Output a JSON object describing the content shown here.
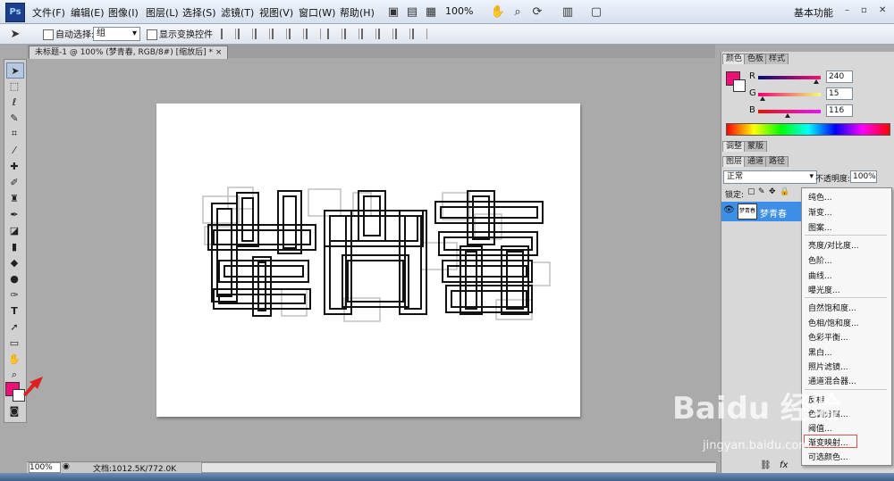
{
  "app": {
    "logo_text": "Ps"
  },
  "menu": [
    "文件(F)",
    "编辑(E)",
    "图像(I)",
    "图层(L)",
    "选择(S)",
    "滤镜(T)",
    "视图(V)",
    "窗口(W)",
    "帮助(H)"
  ],
  "toolbar": {
    "zoom_level": "100%",
    "workspace": "基本功能"
  },
  "options_bar": {
    "auto_select_label": "自动选择:",
    "auto_select_value": "组",
    "show_transform_label": "显示变换控件"
  },
  "document_tab": {
    "title": "未标题-1 @ 100% (梦青春, RGB/8#) [缩放后] *",
    "close": "×"
  },
  "status_bar": {
    "zoom": "100%",
    "doc_info": "文档:1012.5K/772.0K"
  },
  "color_panel": {
    "tabs": [
      "颜色",
      "色板",
      "样式"
    ],
    "R": {
      "label": "R",
      "value": "240"
    },
    "G": {
      "label": "G",
      "value": "15"
    },
    "B": {
      "label": "B",
      "value": "116"
    },
    "foreground": "#f00f74",
    "background": "#ffffff"
  },
  "adjust_panel": {
    "tabs": [
      "调整",
      "蒙版"
    ]
  },
  "layers_panel": {
    "tabs": [
      "图层",
      "通道",
      "路径"
    ],
    "blend_mode": "正常",
    "opacity_label": "不透明度:",
    "opacity_value": "100%",
    "lock_label": "锁定:",
    "layer_name": "梦青春",
    "layer_thumb_text": "梦青春"
  },
  "adjustment_menu": {
    "items": [
      "纯色...",
      "渐变...",
      "图案...",
      "亮度/对比度...",
      "色阶...",
      "曲线...",
      "曝光度...",
      "自然饱和度...",
      "色相/饱和度...",
      "色彩平衡...",
      "黑白...",
      "照片滤镜...",
      "通道混合器...",
      "反相",
      "色调分离...",
      "阈值...",
      "渐变映射...",
      "可选颜色..."
    ],
    "highlighted": "渐变映射..."
  },
  "watermark": {
    "text": "Baidu 经验",
    "url": "jingyan.baidu.com"
  }
}
